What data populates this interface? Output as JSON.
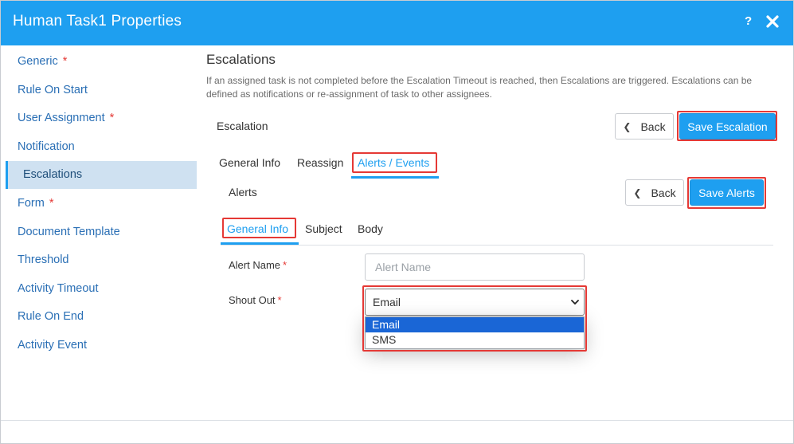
{
  "window": {
    "title": "Human Task1 Properties",
    "help_label": "?"
  },
  "sidebar": {
    "items": [
      {
        "label": "Generic",
        "required": "*"
      },
      {
        "label": "Rule On Start"
      },
      {
        "label": "User Assignment",
        "required": "*"
      },
      {
        "label": "Notification"
      },
      {
        "label": "Escalations",
        "active": true
      },
      {
        "label": "Form",
        "required": "*"
      },
      {
        "label": "Document Template"
      },
      {
        "label": "Threshold"
      },
      {
        "label": "Activity Timeout"
      },
      {
        "label": "Rule On End"
      },
      {
        "label": "Activity Event"
      }
    ]
  },
  "escalations": {
    "title": "Escalations",
    "description": "If an assigned task is not completed before the Escalation Timeout is reached, then Escalations are triggered. Escalations can be defined as notifications or re-assignment of task to other assignees.",
    "header_label": "Escalation",
    "back_label": "Back",
    "save_label": "Save Escalation",
    "tabs": [
      "General Info",
      "Reassign",
      "Alerts / Events"
    ]
  },
  "alerts": {
    "header_label": "Alerts",
    "back_label": "Back",
    "save_label": "Save Alerts",
    "tabs": [
      "General Info",
      "Subject",
      "Body"
    ]
  },
  "form": {
    "alert_name_label": "Alert Name",
    "alert_name_placeholder": "Alert Name",
    "shout_out_label": "Shout Out",
    "required_mark": "*",
    "shout_out_value": "Email",
    "shout_out_options": [
      "Email",
      "SMS"
    ]
  },
  "colors": {
    "accent": "#1e9ff0",
    "highlight": "#e53935",
    "sidebar_active": "#cfe1f1",
    "selected_option": "#1a66d6"
  }
}
